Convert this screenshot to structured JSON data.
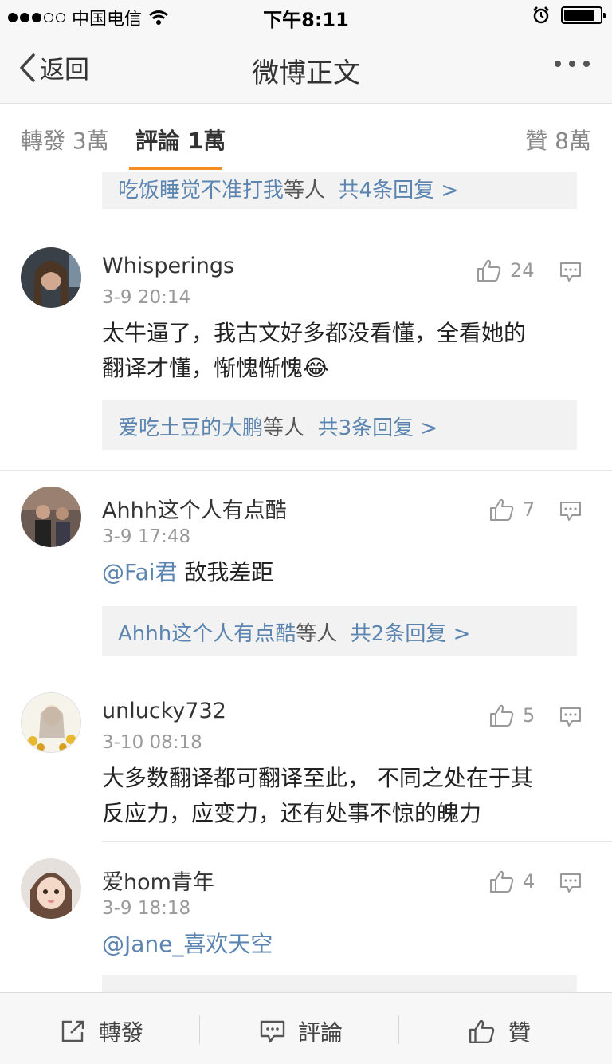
{
  "status_bar": {
    "carrier": "中国电信",
    "time": "下午8:11"
  },
  "nav": {
    "back_label": "返回",
    "title": "微博正文"
  },
  "tabs": [
    {
      "label": "轉發 3萬",
      "active": false
    },
    {
      "label": "評論 1萬",
      "active": true
    },
    {
      "label": "贊 8萬",
      "active": false
    }
  ],
  "top_reply": {
    "names": "吃饭睡觉不准打我",
    "middle": "等人",
    "count": "共4条回复 >"
  },
  "comments": [
    {
      "username": "Whisperings",
      "time": "3-9 20:14",
      "likes": "24",
      "text_line1": "太牛逼了，我古文好多都没看懂，全看她的",
      "text_line2": "翻译才懂，惭愧惭愧",
      "emoji": "😂",
      "reply_names": "爱吃土豆的大鹏",
      "reply_middle": "等人",
      "reply_count": "共3条回复 >"
    },
    {
      "username": "Ahhh这个人有点酷",
      "time": "3-9 17:48",
      "likes": "7",
      "mention": "@Fai君",
      "text": " 敌我差距",
      "reply_names": "Ahhh这个人有点酷",
      "reply_middle": "等人",
      "reply_count": "共2条回复 >"
    },
    {
      "username": "unlucky732",
      "time": "3-10 08:18",
      "likes": "5",
      "text_line1": "大多数翻译都可翻译至此， 不同之处在于其",
      "text_line2": "反应力，应变力，还有处事不惊的魄力"
    },
    {
      "username": "爱hom青年",
      "time": "3-9 18:18",
      "likes": "4",
      "mention": "@Jane_喜欢天空"
    }
  ],
  "bottom_bar": {
    "repost": "轉發",
    "comment": "評論",
    "like": "贊"
  },
  "colors": {
    "accent": "#f58d24",
    "link": "#5b85b0",
    "reply_bg": "#f2f2f2"
  }
}
